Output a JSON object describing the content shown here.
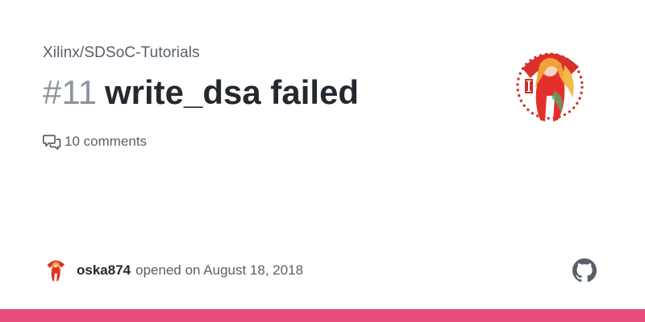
{
  "repo": {
    "full_name": "Xilinx/SDSoC-Tutorials"
  },
  "issue": {
    "number": "#11",
    "title": "write_dsa failed",
    "comments_label": "10 comments",
    "author": "oska874",
    "opened_text": "opened on August 18, 2018"
  },
  "icons": {
    "comments": "comment-discussion-icon",
    "brand": "github-mark-icon"
  },
  "colors": {
    "accent_bar": "#e94d7b",
    "title": "#24292f",
    "muted": "#57606a",
    "issue_number": "#8b949e"
  }
}
